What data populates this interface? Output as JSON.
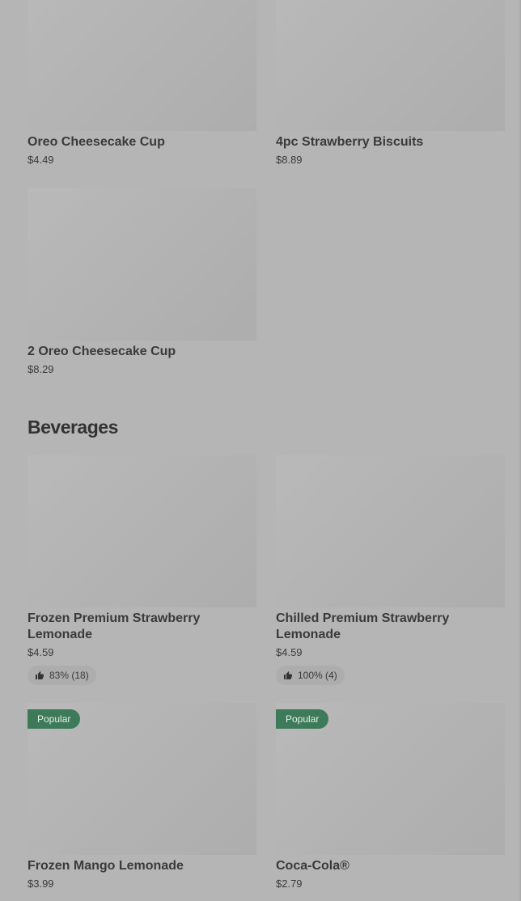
{
  "top_items": [
    {
      "name": "Oreo Cheesecake Cup",
      "price": "$4.49"
    },
    {
      "name": "4pc Strawberry Biscuits",
      "price": "$8.89"
    },
    {
      "name": "2 Oreo Cheesecake Cup",
      "price": "$8.29"
    }
  ],
  "beverages": {
    "title": "Beverages",
    "items": [
      {
        "name": "Frozen Premium Strawberry Lemonade",
        "price": "$4.59",
        "rating": "83% (18)"
      },
      {
        "name": "Chilled Premium Strawberry Lemonade",
        "price": "$4.59",
        "rating": "100% (4)"
      },
      {
        "name": "Frozen Mango Lemonade",
        "price": "$3.99",
        "badge": "Popular"
      },
      {
        "name": "Coca-Cola®",
        "price": "$2.79",
        "badge": "Popular"
      }
    ]
  },
  "icons": {
    "rating": "thumbs-up-icon"
  },
  "colors": {
    "background": "#b5b5b5",
    "badge": "#3d7a5a"
  }
}
